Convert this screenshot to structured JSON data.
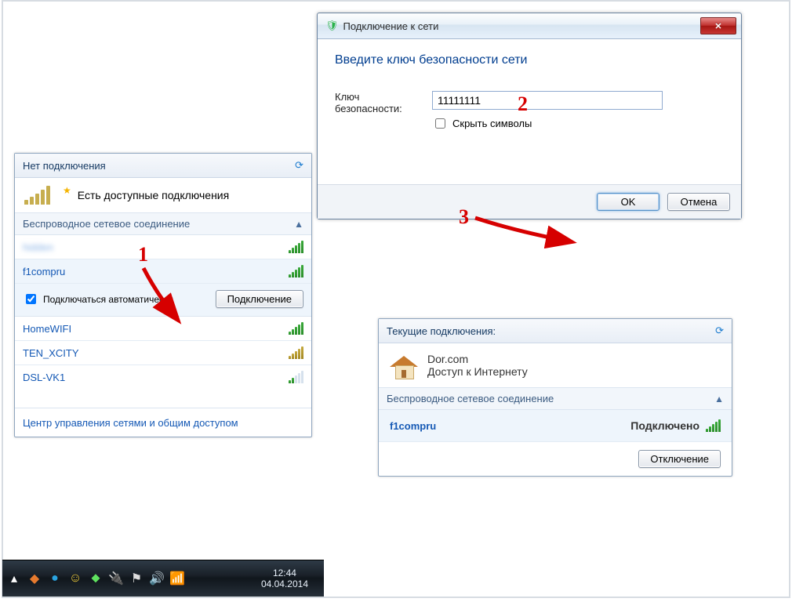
{
  "callouts": {
    "one": "1",
    "two": "2",
    "three": "3"
  },
  "netlist": {
    "header": "Нет подключения",
    "status_avail": "Есть доступные подключения",
    "wifi_section": "Беспроводное сетевое соединение",
    "items": [
      {
        "name": ""
      },
      {
        "name": "f1compru"
      },
      {
        "name": "HomeWIFI"
      },
      {
        "name": "TEN_XCITY"
      },
      {
        "name": "DSL-VK1"
      }
    ],
    "auto_connect": "Подключаться автоматически",
    "connect_btn": "Подключение",
    "footer": "Центр управления сетями и общим доступом"
  },
  "dialog": {
    "title": "Подключение к сети",
    "heading": "Введите ключ безопасности сети",
    "key_label": "Ключ безопасности:",
    "key_value": "11111111",
    "hide_label": "Скрыть символы",
    "ok": "OK",
    "cancel": "Отмена"
  },
  "conn": {
    "title": "Текущие подключения:",
    "ssid_top": "Dor.com",
    "status_top": "Доступ к Интернету",
    "wifi_section": "Беспроводное сетевое соединение",
    "ssid": "f1compru",
    "status": "Подключено",
    "disconnect": "Отключение"
  },
  "taskbar": {
    "time": "12:44",
    "date": "04.04.2014"
  }
}
